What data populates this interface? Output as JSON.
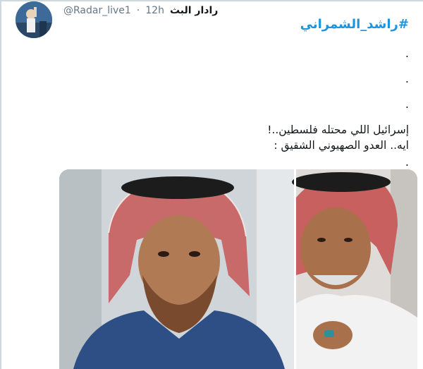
{
  "tweet": {
    "author_name": "رادار البث",
    "handle": "@Radar_live1",
    "separator": "·",
    "time": "12h",
    "hashtag": "#راشد_الشمراني",
    "dots": [
      ".",
      ".",
      ".",
      "."
    ],
    "lines": [
      "إسرائيل اللي محتله فلسطين..!",
      "ايه.. العدو الصهيوني الشقيق :"
    ]
  },
  "colors": {
    "accent": "#1b95e0",
    "text": "#14171a",
    "muted": "#657786"
  },
  "icons": {
    "avatar": "user-avatar-photo",
    "media": "two-photo-collage"
  }
}
